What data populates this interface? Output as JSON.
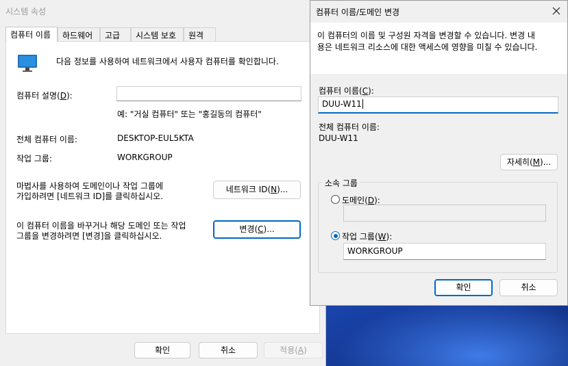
{
  "system_properties": {
    "title": "시스템 속성",
    "tabs": [
      "컴퓨터 이름",
      "하드웨어",
      "고급",
      "시스템 보호",
      "원격"
    ],
    "intro": "다음 정보를 사용하여 네트워크에서 사용자 컴퓨터를 확인합니다.",
    "desc_label": "컴퓨터 설명(D):",
    "desc_value": "",
    "desc_example": "예: \"거실 컴퓨터\" 또는 \"홍길동의 컴퓨터\"",
    "full_name_label": "전체 컴퓨터 이름:",
    "full_name_value": "DESKTOP-EUL5KTA",
    "workgroup_label": "작업 그룹:",
    "workgroup_value": "WORKGROUP",
    "wizard_line1": "마법사를 사용하여 도메인이나 작업 그룹에",
    "wizard_line2": "가입하려면 [네트워크 ID]를 클릭하십시오.",
    "network_id_button": "네트워크 ID(N)...",
    "rename_line1": "이 컴퓨터 이름을 바꾸거나 해당 도메인 또는 작업",
    "rename_line2": "그룹을 변경하려면 [변경]을 클릭하십시오.",
    "change_button": "변경(C)...",
    "ok_button": "확인",
    "cancel_button": "취소",
    "apply_button": "적용(A)"
  },
  "rename_dialog": {
    "title": "컴퓨터 이름/도메인 변경",
    "info_line1": "이 컴퓨터의 이름 및 구성원 자격을 변경할 수 있습니다. 변경 내",
    "info_line2": "용은 네트워크 리소스에 대한 액세스에 영향을 미칠 수 있습니다.",
    "computer_name_label": "컴퓨터 이름(C):",
    "computer_name_value": "DUU-W11",
    "full_name_label": "전체 컴퓨터 이름:",
    "full_name_value": "DUU-W11",
    "more_button": "자세히(M)...",
    "member_of_label": "소속 그룹",
    "domain_label": "도메인(D):",
    "domain_value": "",
    "workgroup_label": "작업 그룹(W):",
    "workgroup_value": "WORKGROUP",
    "workgroup_selected": true,
    "ok_button": "확인",
    "cancel_button": "취소"
  },
  "colors": {
    "accent": "#0067c0",
    "window_bg": "#f0f0f0"
  },
  "icons": [
    "monitor-icon",
    "close-icon"
  ]
}
